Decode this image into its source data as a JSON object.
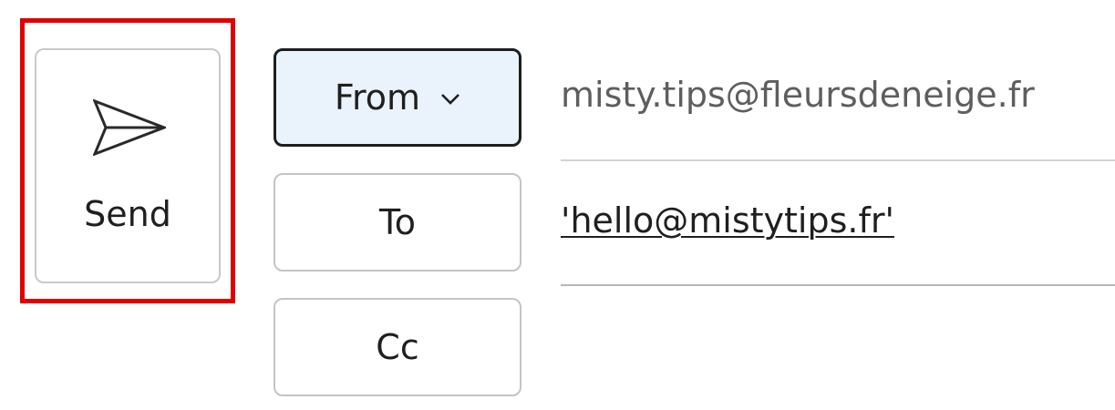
{
  "compose": {
    "send": {
      "label": "Send",
      "icon": "send-icon"
    },
    "from": {
      "button_label": "From",
      "icon": "chevron-down-icon",
      "value": "misty.tips@fleursdeneige.fr"
    },
    "to": {
      "button_label": "To",
      "value": "'hello@mistytips.fr'"
    },
    "cc": {
      "button_label": "Cc"
    }
  },
  "colors": {
    "highlight": "#e00000",
    "from_button_bg": "#eaf3fc",
    "from_button_border": "#1e1e1e",
    "button_border": "#c4c4c4"
  }
}
